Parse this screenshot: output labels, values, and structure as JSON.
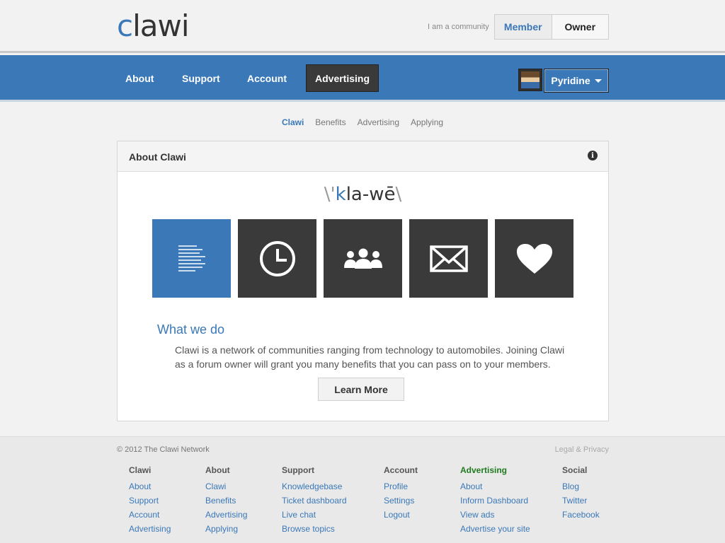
{
  "header": {
    "logo_prefix": "c",
    "logo_rest": "lawi",
    "community_label": "I am a community",
    "member_label": "Member",
    "owner_label": "Owner"
  },
  "nav": {
    "items": [
      {
        "label": "About"
      },
      {
        "label": "Support"
      },
      {
        "label": "Account"
      },
      {
        "label": "Advertising"
      }
    ],
    "active": "Advertising",
    "user_name": "Pyridine"
  },
  "subnav": {
    "items": [
      "Clawi",
      "Benefits",
      "Advertising",
      "Applying"
    ],
    "current": "Clawi"
  },
  "panel": {
    "title": "About Clawi",
    "pron_open": "\\'",
    "pron_k": "k",
    "pron_rest": "la-wē",
    "pron_close": "\\",
    "tiles": [
      "document-lines-icon",
      "clock-icon",
      "people-icon",
      "envelope-icon",
      "heart-icon"
    ],
    "section_title": "What we do",
    "section_body": "Clawi is a network of communities ranging from technology to automobiles. Joining Clawi as a forum owner will grant you many benefits that you can pass on to your members.",
    "learn_more": "Learn More"
  },
  "footer": {
    "copyright": "© 2012 The Clawi Network",
    "legal": "Legal & Privacy",
    "columns": [
      {
        "title": "Clawi",
        "links": [
          "About",
          "Support",
          "Account",
          "Advertising"
        ]
      },
      {
        "title": "About",
        "links": [
          "Clawi",
          "Benefits",
          "Advertising",
          "Applying"
        ]
      },
      {
        "title": "Support",
        "links": [
          "Knowledgebase",
          "Ticket dashboard",
          "Live chat",
          "Browse topics"
        ]
      },
      {
        "title": "Account",
        "links": [
          "Profile",
          "Settings",
          "Logout"
        ]
      },
      {
        "title": "Advertising",
        "links": [
          "About",
          "Inform Dashboard",
          "View ads",
          "Advertise your site"
        ]
      },
      {
        "title": "Social",
        "links": [
          "Blog",
          "Twitter",
          "Facebook"
        ]
      }
    ]
  },
  "colors": {
    "accent": "#3a78b8",
    "dark_tile": "#3a3a3a",
    "advertising_heading": "#1f7a1f"
  }
}
